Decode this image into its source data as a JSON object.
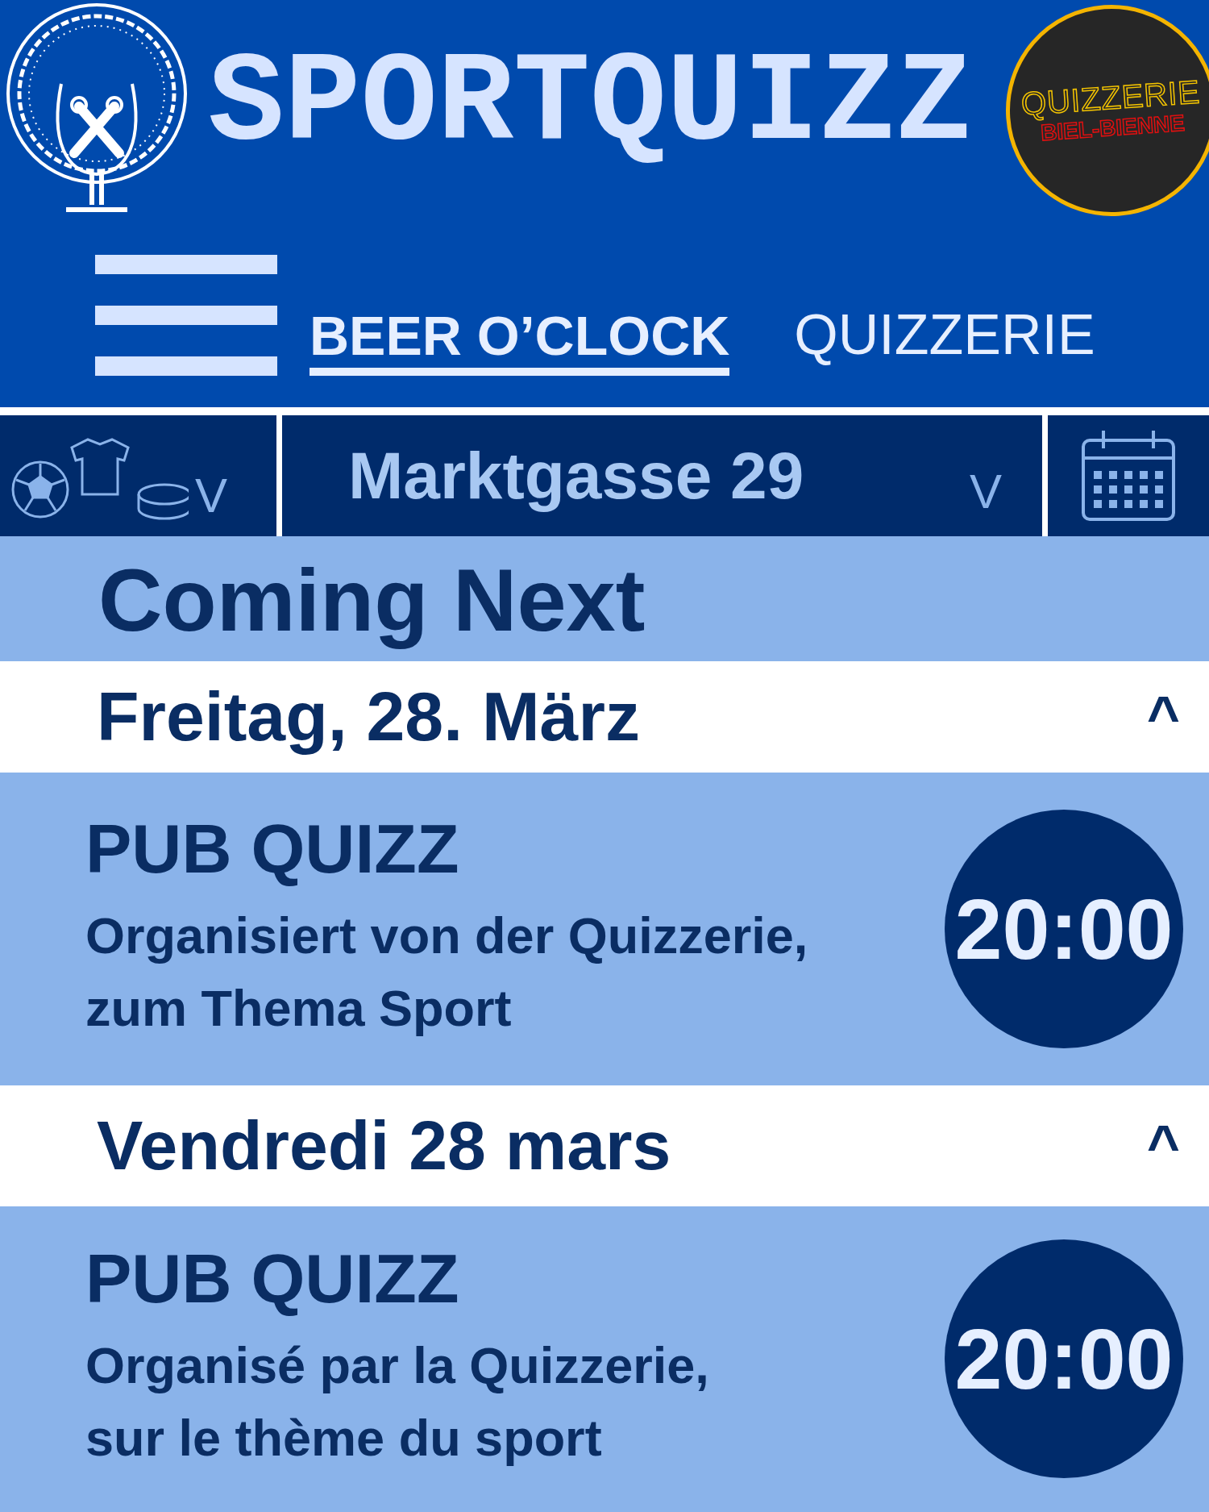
{
  "header": {
    "title": "SPORTQUIZZ",
    "badge": {
      "line_1": "QUIZZERIE",
      "line_2": "BIEL-BIENNE"
    }
  },
  "nav": {
    "tabs": [
      {
        "label": "BEER O’CLOCK",
        "selected": true
      },
      {
        "label": "QUIZZERIE",
        "selected": false
      }
    ]
  },
  "filters": {
    "sport_caret": "V",
    "location": "Marktgasse 29",
    "location_caret": "V"
  },
  "section_title": "Coming Next",
  "days": [
    {
      "label": "Freitag, 28. März",
      "toggle": "^",
      "expanded": true,
      "events": [
        {
          "title": "PUB QUIZZ",
          "description": [
            "Organisiert von der Quizzerie,",
            "zum Thema Sport"
          ],
          "time": "20:00"
        }
      ]
    },
    {
      "label": "Vendredi 28 mars",
      "toggle": "^",
      "expanded": true,
      "events": [
        {
          "title": "PUB QUIZZ",
          "description": [
            "Organisé par la Quizzerie,",
            "sur le thème du sport"
          ],
          "time": "20:00"
        }
      ]
    }
  ]
}
